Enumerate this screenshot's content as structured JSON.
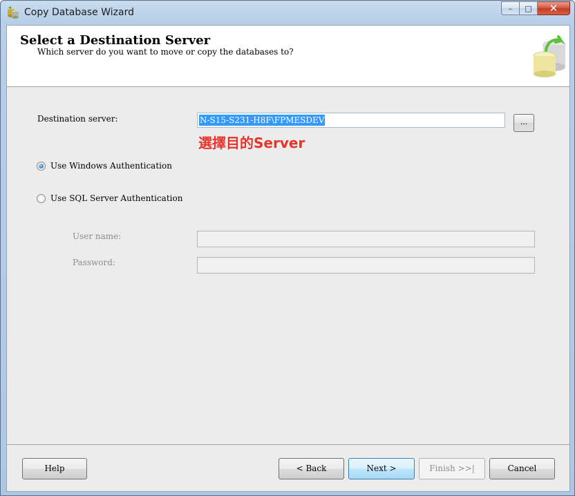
{
  "window": {
    "title": "Copy Database Wizard",
    "controls": {
      "minimize": "–",
      "maximize": "□",
      "close": "✕"
    }
  },
  "header": {
    "title": "Select a Destination Server",
    "subtitle": "Which server do you want to move or copy the databases to?",
    "icon": "database-copy-icon"
  },
  "form": {
    "destination_label": "Destination server:",
    "destination_value": "N-S15-S231-H8F\\FPMESDEV",
    "browse_label": "...",
    "annotation": "選擇目的Server",
    "annotation_color": "#e8332a",
    "windows_auth_label": "Use Windows Authentication",
    "sql_auth_label": "Use SQL Server Authentication",
    "selected_auth": "windows",
    "username_label": "User name:",
    "password_label": "Password:",
    "username_value": "",
    "password_value": ""
  },
  "footer": {
    "help": "Help",
    "back": "< Back",
    "next": "Next >",
    "finish": "Finish >>|",
    "cancel": "Cancel"
  }
}
